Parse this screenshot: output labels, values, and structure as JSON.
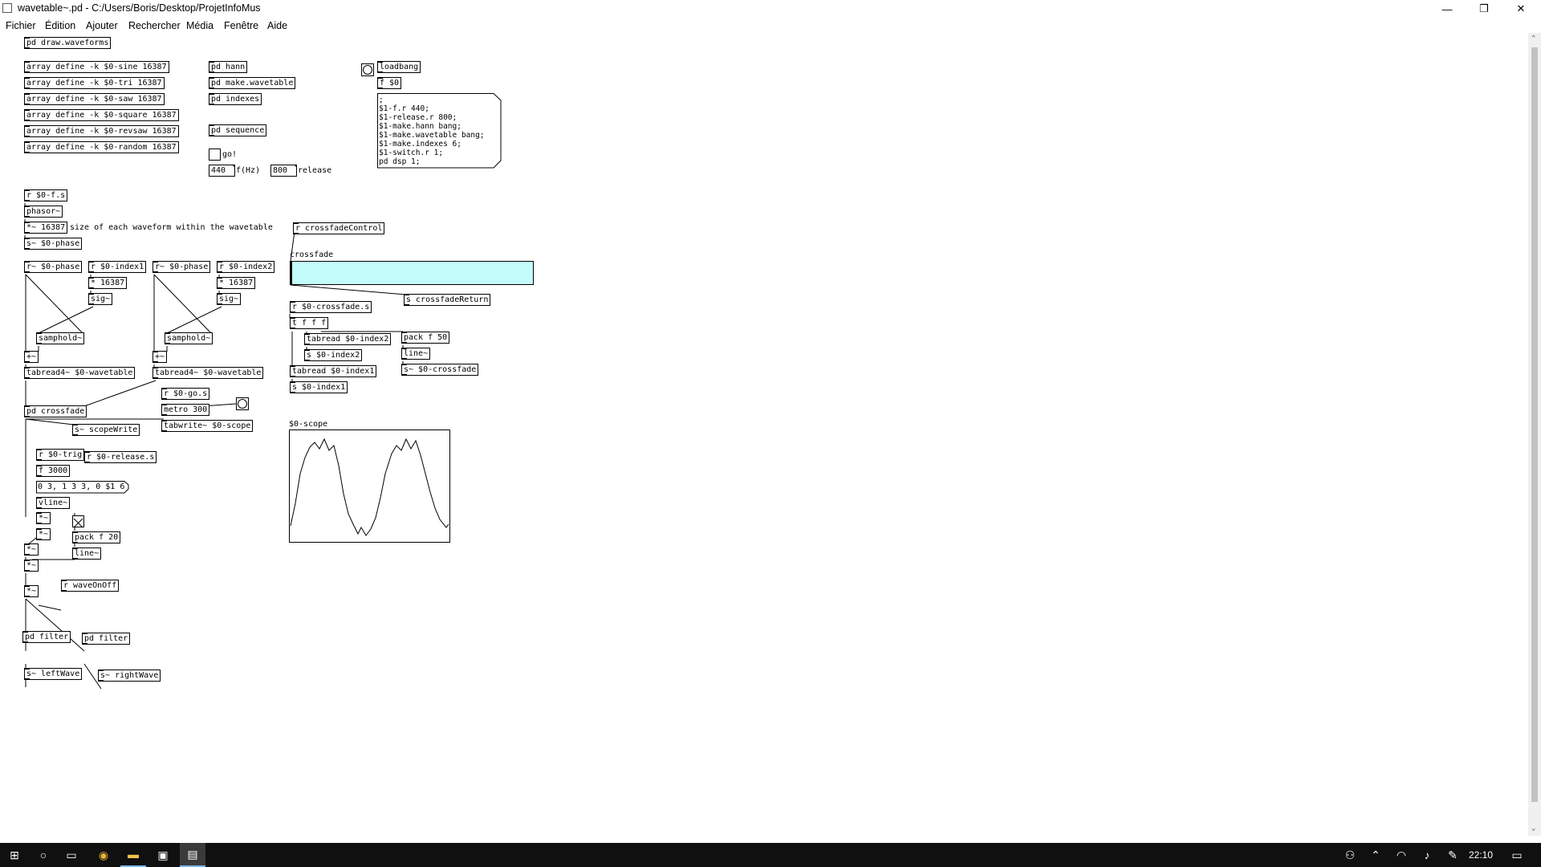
{
  "window": {
    "title": "wavetable~.pd  - C:/Users/Boris/Desktop/ProjetInfoMus",
    "minimize": "—",
    "restore": "❐",
    "close": "✕"
  },
  "menu": [
    "Fichier",
    "Édition",
    "Ajouter",
    "Rechercher",
    "Média",
    "Fenêtre",
    "Aide"
  ],
  "objects": {
    "draw_waveforms": "pd draw.waveforms",
    "arr_sine": "array define -k $0-sine 16387",
    "arr_tri": "array define -k $0-tri 16387",
    "arr_saw": "array define -k $0-saw 16387",
    "arr_square": "array define -k $0-square 16387",
    "arr_revsaw": "array define -k $0-revsaw 16387",
    "arr_random": "array define -k $0-random 16387",
    "pd_hann": "pd hann",
    "pd_make_wavetable": "pd make.wavetable",
    "pd_indexes": "pd indexes",
    "pd_sequence": "pd sequence",
    "loadbang": "loadbang",
    "f_0": "f $0",
    "r_fs": "r $0-f.s",
    "phasor": "phasor~",
    "mul_16387": "*~ 16387",
    "s_phase": "s~ $0-phase",
    "r_phase_1": "r~ $0-phase",
    "r_index1": "r $0-index1",
    "mul_a": "* 16387",
    "sig_a": "sig~",
    "samphold_a": "samphold~",
    "plus_a": "+~",
    "tabread_a": "tabread4~ $0-wavetable",
    "r_phase_2": "r~ $0-phase",
    "r_index2": "r $0-index2",
    "mul_b": "* 16387",
    "sig_b": "sig~",
    "samphold_b": "samphold~",
    "plus_b": "+~",
    "tabread_b": "tabread4~ $0-wavetable",
    "r_crossfade_control": "r crossfadeControl",
    "s_crossfade_return": "s crossfadeReturn",
    "r_crossfade_s": "r $0-crossfade.s",
    "t_fff": "t f f f",
    "tabread_index2": "tabread $0-index2",
    "s_index2": "s $0-index2",
    "tabread_index1": "tabread $0-index1",
    "s_index1": "s $0-index1",
    "pack_f50": "pack f 50",
    "line_ctl": "line~",
    "s_crossfade": "s~ $0-crossfade",
    "pd_crossfade": "pd crossfade",
    "s_scopewrite": "s~ scopeWrite",
    "r_go": "r $0-go.s",
    "metro": "metro 300",
    "tabwrite": "tabwrite~ $0-scope",
    "r_trig": "r $0-trig",
    "r_release": "r $0-release.s",
    "f_3000": "f 3000",
    "vline": "vline~",
    "mul_env1": "*~",
    "mul_env2": "*~",
    "pack_f20": "pack f 20",
    "line_env": "line~",
    "mul_c": "*~",
    "mul_d": "*~",
    "mul_e": "*~",
    "r_waveonoff": "r waveOnOff",
    "pd_filter_l": "pd filter",
    "pd_filter_r": "pd filter",
    "s_leftwave": "s~ leftWave",
    "s_rightwave": "s~ rightWave"
  },
  "messages": {
    "init": ";\n$1-f.r 440;\n$1-release.r 800;\n$1-make.hann bang;\n$1-make.wavetable bang;\n$1-make.indexes 6;\n$1-switch.r 1;\npd dsp 1;",
    "envelope": "0 3, 1 3 3, 0 $1 6"
  },
  "comments": {
    "size_note": "size of each waveform within the wavetable",
    "go": "go!",
    "fhz": "f(Hz)",
    "release": "release",
    "crossfade": "crossfade",
    "scope": "$0-scope"
  },
  "numbers": {
    "freq": "440",
    "release": "800"
  },
  "slider": {
    "color": "#c4fcfc",
    "value": 0.0
  },
  "taskbar": {
    "clock": "22:10",
    "icons": [
      "windows-start-icon",
      "search-circle-icon",
      "task-view-icon",
      "chrome-icon",
      "file-explorer-icon",
      "store-icon",
      "pd-app-icon"
    ],
    "tray_icons": [
      "people-icon",
      "chevron-up-icon",
      "wifi-icon",
      "volume-icon",
      "pen-icon",
      "notification-icon"
    ]
  }
}
